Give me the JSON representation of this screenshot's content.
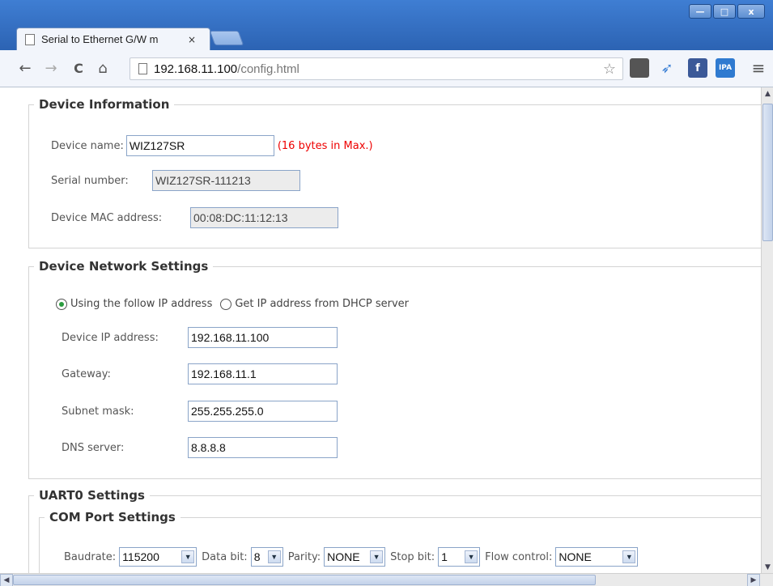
{
  "browser": {
    "tab_title": "Serial to Ethernet G/W m",
    "tab_close": "×",
    "url_host": "192.168.11.100",
    "url_path": "/config.html",
    "win_min": "—",
    "win_max": "□",
    "win_close": "x",
    "back": "←",
    "forward": "→",
    "reload": "C",
    "home": "⌂",
    "star": "☆",
    "menu": "≡"
  },
  "device_info": {
    "legend": "Device Information",
    "name_label": "Device name:",
    "name_value": "WIZ127SR",
    "name_hint": "(16 bytes in Max.)",
    "serial_label": "Serial number:",
    "serial_value": "WIZ127SR-111213",
    "mac_label": "Device MAC address:",
    "mac_value": "00:08:DC:11:12:13"
  },
  "network": {
    "legend": "Device Network Settings",
    "radio_static": "Using the follow IP address",
    "radio_dhcp": "Get IP address from DHCP server",
    "selected": "static",
    "ip_label": "Device IP address:",
    "ip_value": "192.168.11.100",
    "gateway_label": "Gateway:",
    "gateway_value": "192.168.11.1",
    "subnet_label": "Subnet mask:",
    "subnet_value": "255.255.255.0",
    "dns_label": "DNS server:",
    "dns_value": "8.8.8.8"
  },
  "uart": {
    "legend": "UART0 Settings",
    "com_legend": "COM Port Settings",
    "baud_label": "Baudrate:",
    "baud_value": "115200",
    "databit_label": "Data bit:",
    "databit_value": "8",
    "parity_label": "Parity:",
    "parity_value": "NONE",
    "stopbit_label": "Stop bit:",
    "stopbit_value": "1",
    "flow_label": "Flow control:",
    "flow_value": "NONE"
  },
  "colors": {
    "hint_red": "#e00000",
    "titlebar_blue": "#2c63b3",
    "radio_green": "#2b9c3f"
  }
}
